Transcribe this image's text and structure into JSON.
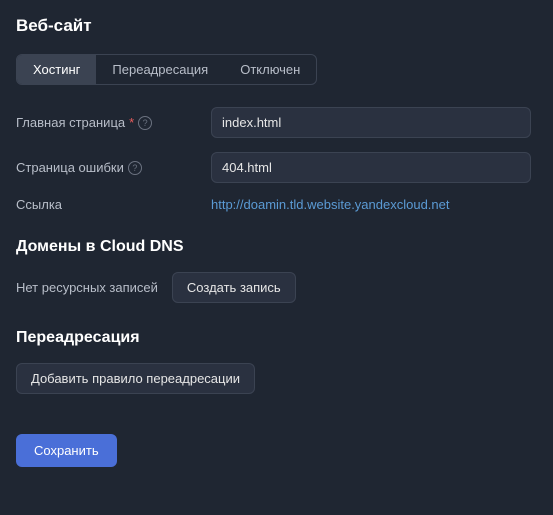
{
  "title": "Веб-сайт",
  "tabs": {
    "hosting": "Хостинг",
    "redirect": "Переадресация",
    "disabled": "Отключен"
  },
  "form": {
    "mainPageLabel": "Главная страница",
    "mainPageValue": "index.html",
    "errorPageLabel": "Страница ошибки",
    "errorPageValue": "404.html",
    "linkLabel": "Ссылка",
    "linkValue": "http://doamin.tld.website.yandexcloud.net"
  },
  "dns": {
    "title": "Домены в Cloud DNS",
    "emptyText": "Нет ресурсных записей",
    "createButton": "Создать запись"
  },
  "redirect": {
    "title": "Переадресация",
    "addButton": "Добавить правило переадресации"
  },
  "saveButton": "Сохранить",
  "helpGlyph": "?"
}
